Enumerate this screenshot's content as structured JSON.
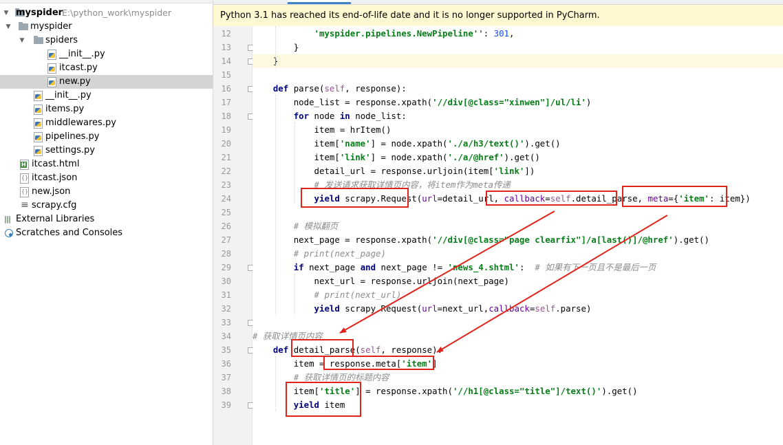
{
  "project": {
    "root_name": "myspider",
    "root_path": "E:\\python_work\\myspider",
    "items": [
      {
        "label": "myspider",
        "kind": "folder",
        "depth": 1,
        "arrow": "down"
      },
      {
        "label": "spiders",
        "kind": "folder",
        "depth": 2,
        "arrow": "down"
      },
      {
        "label": "__init__.py",
        "kind": "py",
        "depth": 3
      },
      {
        "label": "itcast.py",
        "kind": "py",
        "depth": 3
      },
      {
        "label": "new.py",
        "kind": "py",
        "depth": 3,
        "selected": true
      },
      {
        "label": "__init__.py",
        "kind": "py",
        "depth": 2
      },
      {
        "label": "items.py",
        "kind": "py",
        "depth": 2
      },
      {
        "label": "middlewares.py",
        "kind": "py",
        "depth": 2
      },
      {
        "label": "pipelines.py",
        "kind": "py",
        "depth": 2
      },
      {
        "label": "settings.py",
        "kind": "py",
        "depth": 2
      },
      {
        "label": "itcast.html",
        "kind": "html",
        "depth": 1
      },
      {
        "label": "itcast.json",
        "kind": "json",
        "depth": 1
      },
      {
        "label": "new.json",
        "kind": "json",
        "depth": 1
      },
      {
        "label": "scrapy.cfg",
        "kind": "cfg",
        "depth": 1
      },
      {
        "label": "External Libraries",
        "kind": "lib",
        "depth": 0,
        "arrow": "right"
      },
      {
        "label": "Scratches and Consoles",
        "kind": "scratch",
        "depth": 0,
        "arrow": "right"
      }
    ]
  },
  "editor": {
    "banner": "Python 3.1 has reached its end-of-life date and it is no longer supported in PyCharm.",
    "lines": [
      {
        "n": "12",
        "indent": 6,
        "parts": [
          [
            "str",
            "'myspider.pipelines.NewPipeline'"
          ],
          [
            "",
            "': "
          ],
          [
            "num",
            "301"
          ],
          [
            "",
            ","
          ]
        ]
      },
      {
        "n": "13",
        "indent": 4,
        "parts": [
          [
            "",
            "}"
          ]
        ]
      },
      {
        "n": "14",
        "indent": 2,
        "hl": true,
        "parts": [
          [
            "",
            "}"
          ]
        ]
      },
      {
        "n": "15",
        "indent": 0,
        "parts": []
      },
      {
        "n": "16",
        "indent": 2,
        "parts": [
          [
            "kw",
            "def "
          ],
          [
            "fn",
            "parse("
          ],
          [
            "self",
            "self"
          ],
          [
            "",
            ", response):"
          ]
        ]
      },
      {
        "n": "17",
        "indent": 4,
        "parts": [
          [
            "",
            "node_list = response.xpath("
          ],
          [
            "str",
            "'//div[@class=\"xinwen\"]/ul/li'"
          ],
          [
            "",
            ")"
          ]
        ]
      },
      {
        "n": "18",
        "indent": 4,
        "parts": [
          [
            "kw",
            "for "
          ],
          [
            "",
            "node "
          ],
          [
            "kw",
            "in "
          ],
          [
            "",
            "node_list:"
          ]
        ]
      },
      {
        "n": "19",
        "indent": 6,
        "parts": [
          [
            "",
            "item = hrItem()"
          ]
        ]
      },
      {
        "n": "20",
        "indent": 6,
        "parts": [
          [
            "",
            "item["
          ],
          [
            "str",
            "'name'"
          ],
          [
            "",
            "] = node.xpath("
          ],
          [
            "str",
            "'./a/h3/text()'"
          ],
          [
            "",
            ").get()"
          ]
        ]
      },
      {
        "n": "21",
        "indent": 6,
        "parts": [
          [
            "",
            "item["
          ],
          [
            "str",
            "'link'"
          ],
          [
            "",
            "] = node.xpath("
          ],
          [
            "str",
            "'./a/@href'"
          ],
          [
            "",
            ").get()"
          ]
        ]
      },
      {
        "n": "22",
        "indent": 6,
        "parts": [
          [
            "",
            "detail_url = response.urljoin(item["
          ],
          [
            "str",
            "'link'"
          ],
          [
            "",
            "])"
          ]
        ]
      },
      {
        "n": "23",
        "indent": 6,
        "parts": [
          [
            "cmt",
            "# 发送请求获取详情页内容，将item作为meta传递"
          ]
        ]
      },
      {
        "n": "24",
        "indent": 6,
        "parts": [
          [
            "kw",
            "yield "
          ],
          [
            "",
            "scrapy.Request("
          ],
          [
            "param",
            "url"
          ],
          [
            "",
            "=detail_url, "
          ],
          [
            "param",
            "callback"
          ],
          [
            "",
            "="
          ],
          [
            "self",
            "self"
          ],
          [
            "",
            ".detail_parse, "
          ],
          [
            "param",
            "meta"
          ],
          [
            "",
            "={"
          ],
          [
            "str",
            "'item'"
          ],
          [
            "",
            ": item})"
          ]
        ]
      },
      {
        "n": "25",
        "indent": 0,
        "parts": []
      },
      {
        "n": "26",
        "indent": 4,
        "parts": [
          [
            "cmt",
            "# 模拟翻页"
          ]
        ]
      },
      {
        "n": "27",
        "indent": 4,
        "parts": [
          [
            "",
            "next_page = response.xpath("
          ],
          [
            "str",
            "'//div[@class=\"page clearfix\"]/a[last()]/@href'"
          ],
          [
            "",
            ").get()"
          ]
        ]
      },
      {
        "n": "28",
        "indent": 4,
        "parts": [
          [
            "cmt",
            "# print(next_page)"
          ]
        ]
      },
      {
        "n": "29",
        "indent": 4,
        "parts": [
          [
            "kw",
            "if "
          ],
          [
            "",
            "next_page "
          ],
          [
            "kw",
            "and "
          ],
          [
            "",
            "next_page != "
          ],
          [
            "str",
            "'news_4.shtml'"
          ],
          [
            "",
            ":  "
          ],
          [
            "cmt",
            "# 如果有下一页且不是最后一页"
          ]
        ]
      },
      {
        "n": "30",
        "indent": 6,
        "parts": [
          [
            "",
            "next_url = response.urljoin(next_page)"
          ]
        ]
      },
      {
        "n": "31",
        "indent": 6,
        "parts": [
          [
            "cmt",
            "# print(next_url)"
          ]
        ]
      },
      {
        "n": "32",
        "indent": 6,
        "parts": [
          [
            "kw",
            "yield "
          ],
          [
            "",
            "scrapy.Request("
          ],
          [
            "param",
            "url"
          ],
          [
            "",
            "=next_url,"
          ],
          [
            "param",
            "callback"
          ],
          [
            "",
            "="
          ],
          [
            "self",
            "self"
          ],
          [
            "",
            ".parse)"
          ]
        ]
      },
      {
        "n": "33",
        "indent": 0,
        "parts": []
      },
      {
        "n": "34",
        "indent": 0,
        "parts": [
          [
            "cmt",
            "# 获取详情页内容"
          ]
        ]
      },
      {
        "n": "35",
        "indent": 2,
        "parts": [
          [
            "kw",
            "def "
          ],
          [
            "fn",
            "detail_parse("
          ],
          [
            "self",
            "self"
          ],
          [
            "",
            ", response):"
          ]
        ]
      },
      {
        "n": "36",
        "indent": 4,
        "parts": [
          [
            "",
            "item = response.meta["
          ],
          [
            "str",
            "'item'"
          ],
          [
            "",
            "]"
          ]
        ]
      },
      {
        "n": "37",
        "indent": 4,
        "parts": [
          [
            "cmt",
            "# 获取详情页的标题内容"
          ]
        ]
      },
      {
        "n": "38",
        "indent": 4,
        "parts": [
          [
            "",
            "item["
          ],
          [
            "str",
            "'title'"
          ],
          [
            "",
            "] = response.xpath("
          ],
          [
            "str",
            "'//h1[@class=\"title\"]/text()'"
          ],
          [
            "",
            ").get()"
          ]
        ]
      },
      {
        "n": "39",
        "indent": 4,
        "parts": [
          [
            "kw",
            "yield "
          ],
          [
            "",
            "item"
          ]
        ]
      }
    ]
  },
  "colors": {
    "annotation_red": "#e0241b",
    "banner_bg": "#fff8d1",
    "selection_bg": "#d4d4d4",
    "keyword": "#000080",
    "string": "#067d17",
    "comment": "#8c8c8c"
  }
}
